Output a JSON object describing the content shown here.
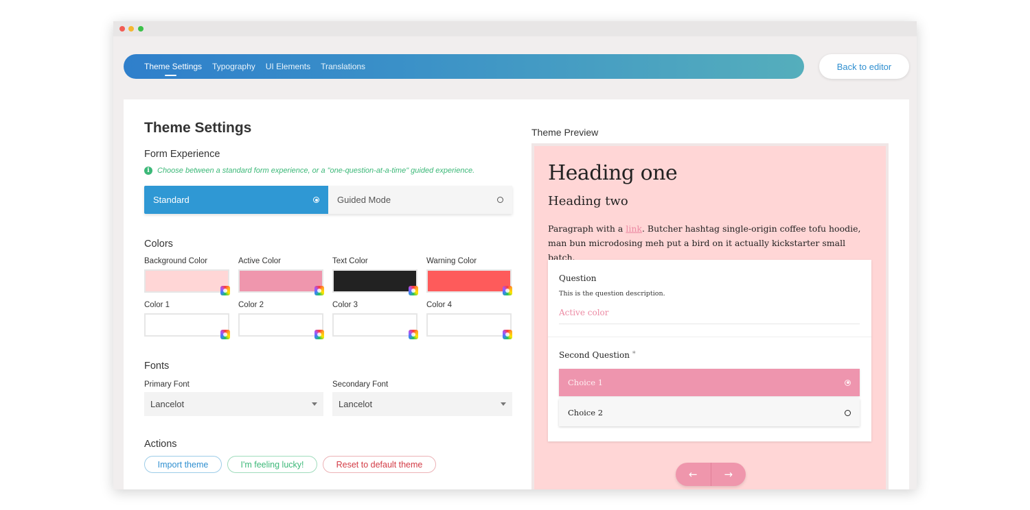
{
  "nav": {
    "tabs": [
      {
        "label": "Theme Settings"
      },
      {
        "label": "Typography"
      },
      {
        "label": "UI Elements"
      },
      {
        "label": "Translations"
      }
    ],
    "back_label": "Back to editor"
  },
  "settings": {
    "title": "Theme Settings",
    "form_experience": {
      "title": "Form Experience",
      "hint": "Choose between a standard form experience, or a \"one-question-at-a-time\" guided experience.",
      "options": [
        {
          "label": "Standard",
          "selected": true
        },
        {
          "label": "Guided Mode",
          "selected": false
        }
      ]
    },
    "colors": {
      "title": "Colors",
      "swatches": [
        {
          "label": "Background Color",
          "value": "#ffd6d6"
        },
        {
          "label": "Active Color",
          "value": "#ef96ad"
        },
        {
          "label": "Text Color",
          "value": "#222222"
        },
        {
          "label": "Warning Color",
          "value": "#fe5b5b"
        },
        {
          "label": "Color 1",
          "value": "#ffffff"
        },
        {
          "label": "Color 2",
          "value": "#ffffff"
        },
        {
          "label": "Color 3",
          "value": "#ffffff"
        },
        {
          "label": "Color 4",
          "value": "#ffffff"
        }
      ]
    },
    "fonts": {
      "title": "Fonts",
      "primary_label": "Primary Font",
      "primary_value": "Lancelot",
      "secondary_label": "Secondary Font",
      "secondary_value": "Lancelot"
    },
    "actions": {
      "title": "Actions",
      "import_label": "Import theme",
      "lucky_label": "I'm feeling lucky!",
      "reset_label": "Reset to default theme"
    }
  },
  "preview": {
    "title": "Theme Preview",
    "heading_one": "Heading one",
    "heading_two": "Heading two",
    "para_before": "Paragraph with a ",
    "para_link": "link",
    "para_after": ". Butcher hashtag single-origin coffee tofu hoodie, man bun microdosing meh put a bird on it actually kickstarter small batch.",
    "q1_title": "Question",
    "q1_desc": "This is the question description.",
    "q1_placeholder": "Active color",
    "q2_title": "Second Question",
    "q2_required": "*",
    "choices": [
      {
        "label": "Choice 1",
        "selected": true
      },
      {
        "label": "Choice 2",
        "selected": false
      }
    ],
    "prev_icon": "←",
    "next_icon": "→"
  },
  "colors": {
    "nav_gradient_start": "#2f7fcb",
    "nav_gradient_end": "#55aebc",
    "accent_blue": "#2f98d4",
    "accent_green": "#3cb878",
    "accent_red": "#d33a44"
  }
}
